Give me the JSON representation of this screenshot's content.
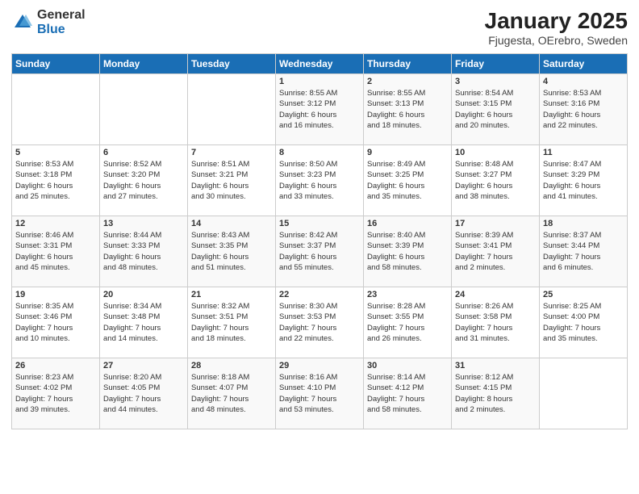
{
  "logo": {
    "general": "General",
    "blue": "Blue"
  },
  "title": "January 2025",
  "subtitle": "Fjugesta, OErebro, Sweden",
  "days_of_week": [
    "Sunday",
    "Monday",
    "Tuesday",
    "Wednesday",
    "Thursday",
    "Friday",
    "Saturday"
  ],
  "weeks": [
    [
      {
        "day": "",
        "detail": ""
      },
      {
        "day": "",
        "detail": ""
      },
      {
        "day": "",
        "detail": ""
      },
      {
        "day": "1",
        "detail": "Sunrise: 8:55 AM\nSunset: 3:12 PM\nDaylight: 6 hours\nand 16 minutes."
      },
      {
        "day": "2",
        "detail": "Sunrise: 8:55 AM\nSunset: 3:13 PM\nDaylight: 6 hours\nand 18 minutes."
      },
      {
        "day": "3",
        "detail": "Sunrise: 8:54 AM\nSunset: 3:15 PM\nDaylight: 6 hours\nand 20 minutes."
      },
      {
        "day": "4",
        "detail": "Sunrise: 8:53 AM\nSunset: 3:16 PM\nDaylight: 6 hours\nand 22 minutes."
      }
    ],
    [
      {
        "day": "5",
        "detail": "Sunrise: 8:53 AM\nSunset: 3:18 PM\nDaylight: 6 hours\nand 25 minutes."
      },
      {
        "day": "6",
        "detail": "Sunrise: 8:52 AM\nSunset: 3:20 PM\nDaylight: 6 hours\nand 27 minutes."
      },
      {
        "day": "7",
        "detail": "Sunrise: 8:51 AM\nSunset: 3:21 PM\nDaylight: 6 hours\nand 30 minutes."
      },
      {
        "day": "8",
        "detail": "Sunrise: 8:50 AM\nSunset: 3:23 PM\nDaylight: 6 hours\nand 33 minutes."
      },
      {
        "day": "9",
        "detail": "Sunrise: 8:49 AM\nSunset: 3:25 PM\nDaylight: 6 hours\nand 35 minutes."
      },
      {
        "day": "10",
        "detail": "Sunrise: 8:48 AM\nSunset: 3:27 PM\nDaylight: 6 hours\nand 38 minutes."
      },
      {
        "day": "11",
        "detail": "Sunrise: 8:47 AM\nSunset: 3:29 PM\nDaylight: 6 hours\nand 41 minutes."
      }
    ],
    [
      {
        "day": "12",
        "detail": "Sunrise: 8:46 AM\nSunset: 3:31 PM\nDaylight: 6 hours\nand 45 minutes."
      },
      {
        "day": "13",
        "detail": "Sunrise: 8:44 AM\nSunset: 3:33 PM\nDaylight: 6 hours\nand 48 minutes."
      },
      {
        "day": "14",
        "detail": "Sunrise: 8:43 AM\nSunset: 3:35 PM\nDaylight: 6 hours\nand 51 minutes."
      },
      {
        "day": "15",
        "detail": "Sunrise: 8:42 AM\nSunset: 3:37 PM\nDaylight: 6 hours\nand 55 minutes."
      },
      {
        "day": "16",
        "detail": "Sunrise: 8:40 AM\nSunset: 3:39 PM\nDaylight: 6 hours\nand 58 minutes."
      },
      {
        "day": "17",
        "detail": "Sunrise: 8:39 AM\nSunset: 3:41 PM\nDaylight: 7 hours\nand 2 minutes."
      },
      {
        "day": "18",
        "detail": "Sunrise: 8:37 AM\nSunset: 3:44 PM\nDaylight: 7 hours\nand 6 minutes."
      }
    ],
    [
      {
        "day": "19",
        "detail": "Sunrise: 8:35 AM\nSunset: 3:46 PM\nDaylight: 7 hours\nand 10 minutes."
      },
      {
        "day": "20",
        "detail": "Sunrise: 8:34 AM\nSunset: 3:48 PM\nDaylight: 7 hours\nand 14 minutes."
      },
      {
        "day": "21",
        "detail": "Sunrise: 8:32 AM\nSunset: 3:51 PM\nDaylight: 7 hours\nand 18 minutes."
      },
      {
        "day": "22",
        "detail": "Sunrise: 8:30 AM\nSunset: 3:53 PM\nDaylight: 7 hours\nand 22 minutes."
      },
      {
        "day": "23",
        "detail": "Sunrise: 8:28 AM\nSunset: 3:55 PM\nDaylight: 7 hours\nand 26 minutes."
      },
      {
        "day": "24",
        "detail": "Sunrise: 8:26 AM\nSunset: 3:58 PM\nDaylight: 7 hours\nand 31 minutes."
      },
      {
        "day": "25",
        "detail": "Sunrise: 8:25 AM\nSunset: 4:00 PM\nDaylight: 7 hours\nand 35 minutes."
      }
    ],
    [
      {
        "day": "26",
        "detail": "Sunrise: 8:23 AM\nSunset: 4:02 PM\nDaylight: 7 hours\nand 39 minutes."
      },
      {
        "day": "27",
        "detail": "Sunrise: 8:20 AM\nSunset: 4:05 PM\nDaylight: 7 hours\nand 44 minutes."
      },
      {
        "day": "28",
        "detail": "Sunrise: 8:18 AM\nSunset: 4:07 PM\nDaylight: 7 hours\nand 48 minutes."
      },
      {
        "day": "29",
        "detail": "Sunrise: 8:16 AM\nSunset: 4:10 PM\nDaylight: 7 hours\nand 53 minutes."
      },
      {
        "day": "30",
        "detail": "Sunrise: 8:14 AM\nSunset: 4:12 PM\nDaylight: 7 hours\nand 58 minutes."
      },
      {
        "day": "31",
        "detail": "Sunrise: 8:12 AM\nSunset: 4:15 PM\nDaylight: 8 hours\nand 2 minutes."
      },
      {
        "day": "",
        "detail": ""
      }
    ]
  ]
}
